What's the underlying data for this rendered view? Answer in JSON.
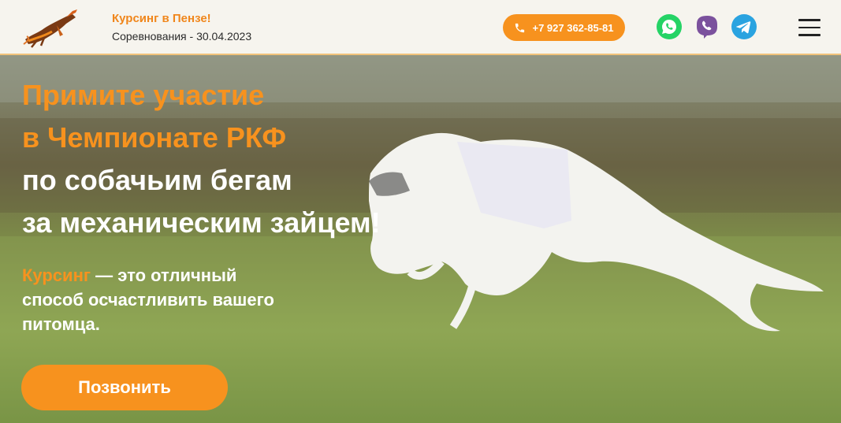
{
  "header": {
    "brand_title": "Курсинг в Пензе!",
    "brand_subtitle": "Соревнования - 30.04.2023",
    "phone": "+7 927 362-85-81",
    "messengers": [
      "whatsapp-icon",
      "viber-icon",
      "telegram-icon"
    ],
    "menu_icon": "hamburger-menu-icon"
  },
  "hero": {
    "title_line1": "Примите участие",
    "title_line2": "в Чемпионате РКФ",
    "title_line3": "по собачьим бегам",
    "title_line4": "за механическим зайцем!",
    "lead_highlight": "Курсинг",
    "lead_line1_rest": " — это отличный",
    "lead_line2": "способ осчастливить вашего",
    "lead_line3": "питомца.",
    "button_label": "Позвонить"
  },
  "colors": {
    "accent": "#f7921e",
    "whatsapp": "#25d366",
    "viber": "#7b519d",
    "telegram": "#2aa3e0"
  }
}
